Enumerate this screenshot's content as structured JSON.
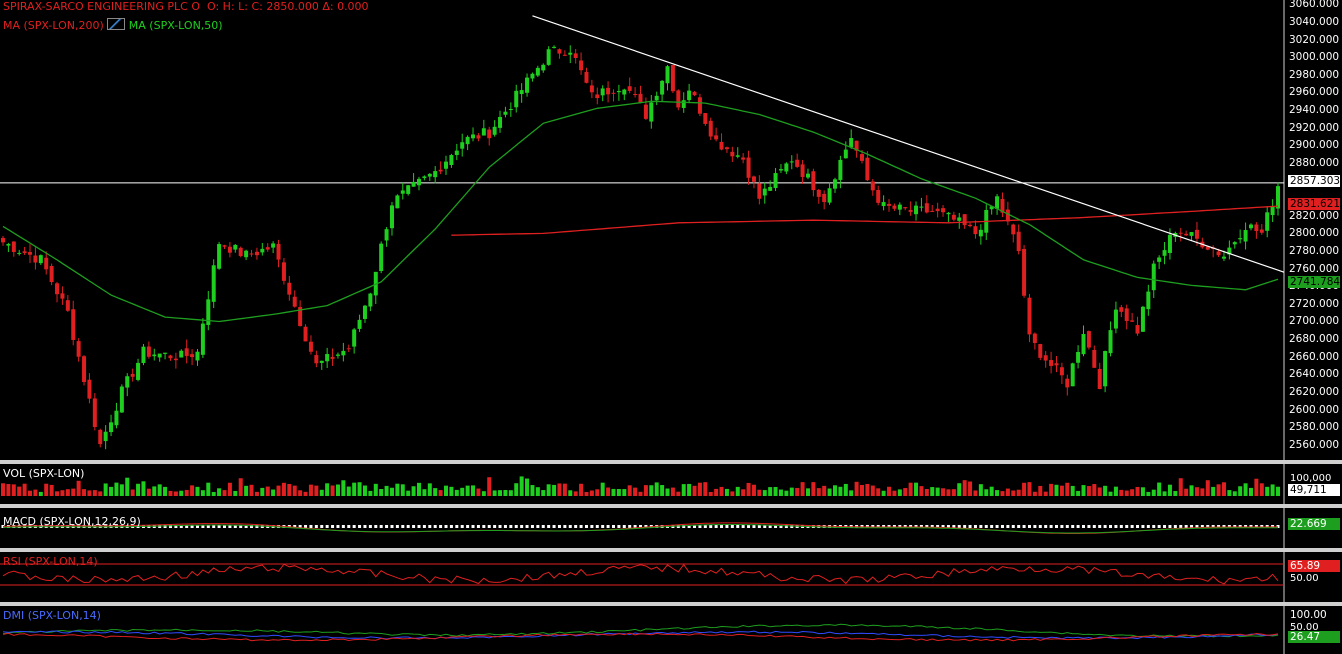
{
  "header": {
    "title": "SPIRAX-SARCO ENGINEERING PLC O",
    "ohlc": "O:    H:    L:    C: 2850.000   Δ: 0.000",
    "ma_long": "MA (SPX-LON,200)",
    "ma_short": "MA (SPX-LON,50)"
  },
  "colors": {
    "up": "#1fcf1f",
    "down": "#e02020",
    "ma200": "#e02020",
    "ma50": "#1e9e1e",
    "trend": "#ffffff",
    "bg": "#000000",
    "separator": "#cfcfcf"
  },
  "price_axis": {
    "ticks": [
      "3060.000",
      "3040.000",
      "3020.000",
      "3000.000",
      "2980.000",
      "2960.000",
      "2940.000",
      "2920.000",
      "2900.000",
      "2880.000",
      "2860.000",
      "2820.000",
      "2800.000",
      "2780.000",
      "2760.000",
      "2740.000",
      "2720.000",
      "2700.000",
      "2680.000",
      "2660.000",
      "2640.000",
      "2620.000",
      "2600.000",
      "2580.000",
      "2560.000"
    ],
    "tag_last": "2857.3035",
    "tag_ma200": "2831.6212",
    "tag_ma50": "2741.7848"
  },
  "volume": {
    "label": "VOL (SPX-LON)",
    "value": "49,711",
    "axis_top": "100,000"
  },
  "macd": {
    "label": "MACD (SPX-LON,12,26,9)",
    "value": "22.669"
  },
  "rsi": {
    "label": "RSI (SPX-LON,14)",
    "value": "65.89",
    "level_mid": "50.00"
  },
  "dmi": {
    "label": "DMI (SPX-LON,14)",
    "value": "26.47",
    "axis_top": "100.00",
    "axis_mid": "50.00"
  },
  "chart_data": {
    "type": "candlestick",
    "ylim": [
      2545,
      3065
    ],
    "horizontal_line": 2857.3,
    "trendline": {
      "from": 3047,
      "to": 2756
    },
    "anchors": [
      [
        0,
        2790
      ],
      [
        7,
        2770
      ],
      [
        12,
        2710
      ],
      [
        18,
        2560
      ],
      [
        22,
        2620
      ],
      [
        26,
        2665
      ],
      [
        33,
        2660
      ],
      [
        36,
        2665
      ],
      [
        37,
        2700
      ],
      [
        40,
        2790
      ],
      [
        45,
        2775
      ],
      [
        50,
        2785
      ],
      [
        58,
        2650
      ],
      [
        64,
        2670
      ],
      [
        68,
        2735
      ],
      [
        72,
        2835
      ],
      [
        80,
        2870
      ],
      [
        85,
        2905
      ],
      [
        90,
        2915
      ],
      [
        95,
        2955
      ],
      [
        101,
        3005
      ],
      [
        105,
        3010
      ],
      [
        109,
        2955
      ],
      [
        115,
        2970
      ],
      [
        119,
        2935
      ],
      [
        123,
        2990
      ],
      [
        125,
        2945
      ],
      [
        127,
        2965
      ],
      [
        132,
        2905
      ],
      [
        137,
        2885
      ],
      [
        140,
        2840
      ],
      [
        146,
        2885
      ],
      [
        152,
        2840
      ],
      [
        157,
        2910
      ],
      [
        160,
        2860
      ],
      [
        163,
        2830
      ],
      [
        168,
        2825
      ],
      [
        172,
        2825
      ],
      [
        176,
        2815
      ],
      [
        180,
        2800
      ],
      [
        184,
        2840
      ],
      [
        188,
        2780
      ],
      [
        190,
        2680
      ],
      [
        194,
        2650
      ],
      [
        197,
        2630
      ],
      [
        200,
        2690
      ],
      [
        203,
        2630
      ],
      [
        206,
        2720
      ],
      [
        210,
        2690
      ],
      [
        213,
        2760
      ],
      [
        217,
        2805
      ],
      [
        222,
        2790
      ],
      [
        226,
        2775
      ],
      [
        230,
        2810
      ],
      [
        233,
        2800
      ],
      [
        236,
        2855
      ]
    ],
    "ma200_anchors": [
      [
        83,
        2798
      ],
      [
        100,
        2800
      ],
      [
        125,
        2812
      ],
      [
        150,
        2815
      ],
      [
        175,
        2812
      ],
      [
        200,
        2818
      ],
      [
        220,
        2825
      ],
      [
        236,
        2831
      ]
    ],
    "ma50_anchors": [
      [
        0,
        2808
      ],
      [
        10,
        2770
      ],
      [
        20,
        2730
      ],
      [
        30,
        2705
      ],
      [
        40,
        2700
      ],
      [
        50,
        2708
      ],
      [
        60,
        2718
      ],
      [
        70,
        2745
      ],
      [
        80,
        2805
      ],
      [
        90,
        2875
      ],
      [
        100,
        2925
      ],
      [
        110,
        2942
      ],
      [
        120,
        2950
      ],
      [
        130,
        2948
      ],
      [
        140,
        2935
      ],
      [
        150,
        2915
      ],
      [
        160,
        2890
      ],
      [
        170,
        2862
      ],
      [
        180,
        2840
      ],
      [
        190,
        2810
      ],
      [
        200,
        2770
      ],
      [
        210,
        2750
      ],
      [
        220,
        2741
      ],
      [
        230,
        2736
      ],
      [
        236,
        2748
      ]
    ]
  }
}
